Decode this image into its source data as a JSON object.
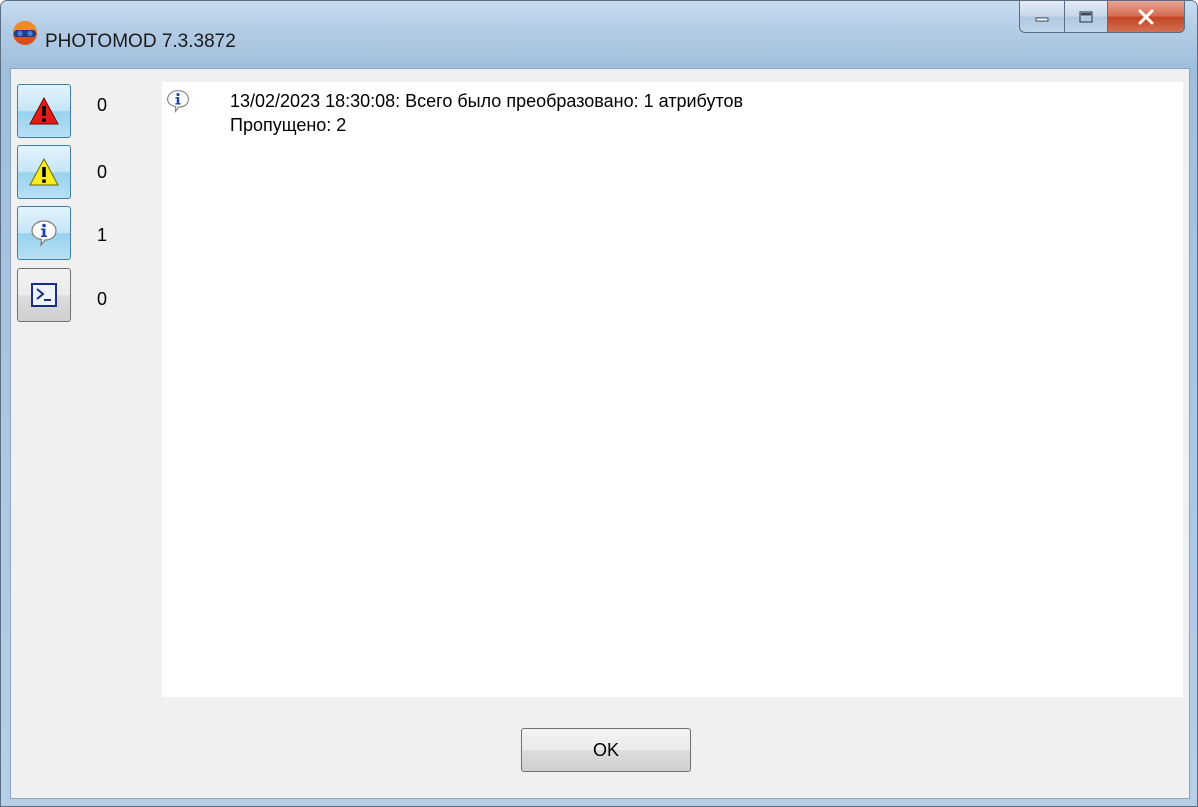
{
  "window": {
    "title": "PHOTOMOD 7.3.3872",
    "app_icon": "photomod-logo-icon",
    "caption_buttons": [
      "minimize-icon",
      "maximize-icon",
      "close-icon"
    ]
  },
  "sidebar": {
    "filters": [
      {
        "icon": "error-icon",
        "count": "0",
        "pressed": true
      },
      {
        "icon": "warning-icon",
        "count": "0",
        "pressed": true
      },
      {
        "icon": "info-icon",
        "count": "1",
        "pressed": true
      },
      {
        "icon": "console-icon",
        "count": "0",
        "pressed": false
      }
    ]
  },
  "log": {
    "entries": [
      {
        "icon": "info-icon",
        "line1": "13/02/2023 18:30:08: Всего было преобразовано: 1 атрибутов",
        "line2": "Пропущено: 2"
      }
    ]
  },
  "footer": {
    "ok_label": "OK"
  },
  "colors": {
    "frame": "#a9c4e0",
    "client_bg": "#f0f0f0",
    "toggle_on": "#98d1ef",
    "error_red": "#e41b17",
    "warning_yellow": "#f7ee20",
    "close_red": "#c2431f"
  }
}
